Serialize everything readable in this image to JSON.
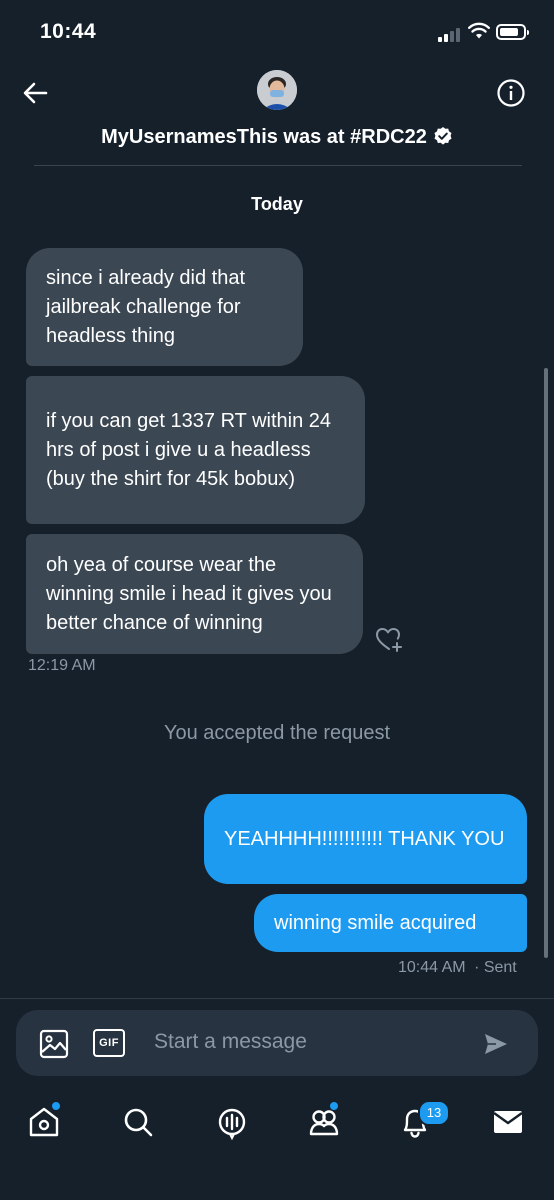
{
  "status_bar": {
    "time": "10:44"
  },
  "header": {
    "title": "MyUsernamesThis was at #RDC22",
    "date_label": "Today"
  },
  "messages": [
    {
      "text": "since i already did that jailbreak challenge for headless thing"
    },
    {
      "text": "if you can get 1337 RT within 24 hrs of post i give u a headless (buy the shirt for 45k bobux)"
    },
    {
      "text": "oh yea of course wear the winning smile i head it gives you better chance of winning"
    }
  ],
  "received_time": "12:19 AM",
  "system_note": "You accepted the request",
  "sent_messages": [
    {
      "text": "YEAHHHH!!!!!!!!!!! THANK YOU"
    },
    {
      "text": "winning smile acquired"
    }
  ],
  "sent_meta": {
    "time": "10:44 AM",
    "status": "· Sent"
  },
  "composer": {
    "placeholder": "Start a message",
    "gif_label": "GIF"
  },
  "tab_bar": {
    "notifications_badge": "13"
  },
  "colors": {
    "background": "#15202b",
    "incoming_bubble": "#3b4753",
    "outgoing_bubble": "#1d9bf0",
    "muted_text": "#8b98a5"
  }
}
